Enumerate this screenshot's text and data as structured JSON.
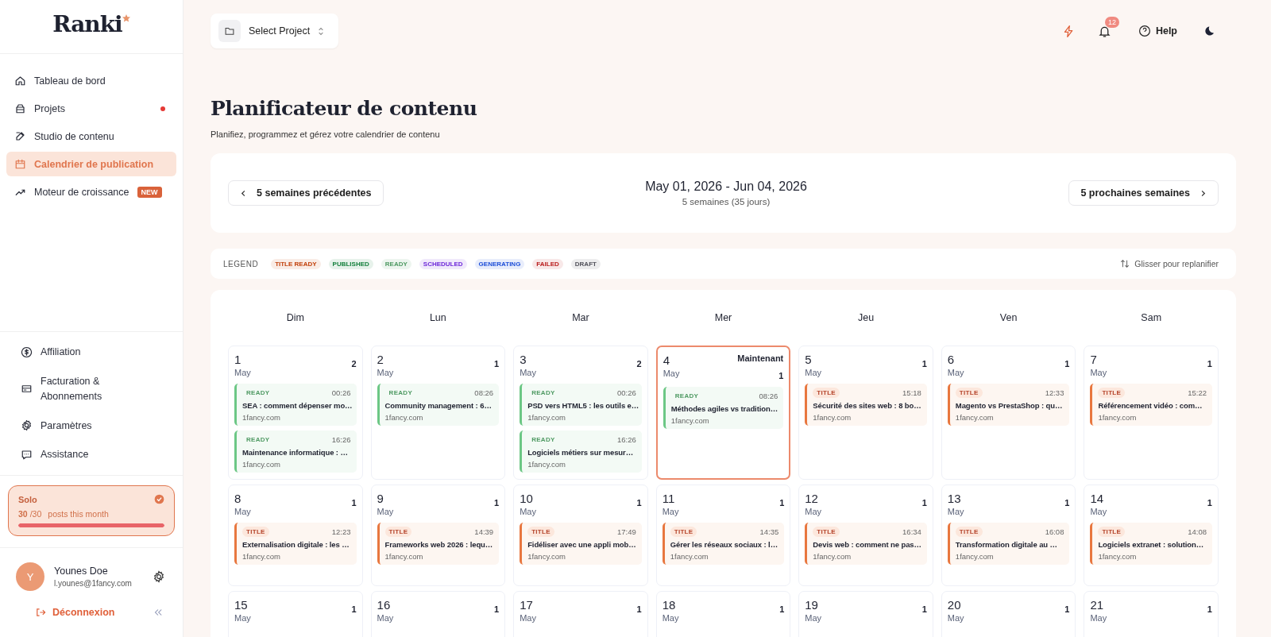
{
  "sidebar": {
    "logo": "Ranki",
    "nav": [
      {
        "label": "Tableau de bord",
        "selected": false,
        "dot": false
      },
      {
        "label": "Projets",
        "selected": false,
        "dot": true
      },
      {
        "label": "Studio de contenu",
        "selected": false,
        "dot": false
      },
      {
        "label": "Calendrier de publication",
        "selected": true,
        "dot": false
      },
      {
        "label": "Moteur de croissance",
        "selected": false,
        "dot": false,
        "badge": "NEW"
      }
    ],
    "secondary": [
      {
        "label": "Affiliation"
      },
      {
        "label": "Facturation & Abonnements"
      },
      {
        "label": "Paramètres"
      },
      {
        "label": "Assistance"
      }
    ],
    "plan": {
      "name": "Solo",
      "used": "30",
      "limit": "/30",
      "caption": "posts this month",
      "level": 1
    },
    "user": {
      "initial": "Y",
      "name": "Younes Doe",
      "email": "l.younes@1fancy.com"
    },
    "logout": "Déconnexion"
  },
  "topbar": {
    "project_select": "Select Project",
    "notifications": "12",
    "help": "Help"
  },
  "page": {
    "title": "Planificateur de contenu",
    "subtitle": "Planifiez, programmez et gérez votre calendrier de contenu"
  },
  "range": {
    "prev": "5 semaines précédentes",
    "title": "May 01, 2026 - Jun 04, 2026",
    "subtitle": "5 semaines (35 jours)",
    "next": "5 prochaines semaines"
  },
  "legend": {
    "label": "LEGEND",
    "hint": "Glisser pour replanifier",
    "items": [
      {
        "label": "TITLE READY",
        "color": "#c2410c"
      },
      {
        "label": "PUBLISHED",
        "color": "#15803d"
      },
      {
        "label": "READY",
        "color": "#4f9a63"
      },
      {
        "label": "SCHEDULED",
        "color": "#6d28d9"
      },
      {
        "label": "GENERATING",
        "color": "#1d4ed8"
      },
      {
        "label": "FAILED",
        "color": "#b91c1c"
      },
      {
        "label": "DRAFT",
        "color": "#52525b"
      }
    ]
  },
  "calendar": {
    "weekdays": [
      "Dim",
      "Lun",
      "Mar",
      "Mer",
      "Jeu",
      "Ven",
      "Sam"
    ],
    "days": [
      {
        "day": "1",
        "month": "May",
        "count": "2",
        "today": false,
        "events": [
          {
            "kind": "ready",
            "tag": "READY",
            "time": "00:26",
            "title": "SEA : comment dépenser mo…",
            "site": "1fancy.com"
          },
          {
            "kind": "ready",
            "tag": "READY",
            "time": "16:26",
            "title": "Maintenance informatique : …",
            "site": "1fancy.com"
          }
        ]
      },
      {
        "day": "2",
        "month": "May",
        "count": "1",
        "today": false,
        "events": [
          {
            "kind": "ready",
            "tag": "READY",
            "time": "08:26",
            "title": "Community management : 6…",
            "site": "1fancy.com"
          }
        ]
      },
      {
        "day": "3",
        "month": "May",
        "count": "2",
        "today": false,
        "events": [
          {
            "kind": "ready",
            "tag": "READY",
            "time": "00:26",
            "title": "PSD vers HTML5 : les outils e…",
            "site": "1fancy.com"
          },
          {
            "kind": "ready",
            "tag": "READY",
            "time": "16:26",
            "title": "Logiciels métiers sur mesur…",
            "site": "1fancy.com"
          }
        ]
      },
      {
        "day": "4",
        "month": "May",
        "count": "1",
        "today": true,
        "today_label": "Maintenant",
        "events": [
          {
            "kind": "ready",
            "tag": "READY",
            "time": "08:26",
            "title": "Méthodes agiles vs tradition…",
            "site": "1fancy.com"
          }
        ]
      },
      {
        "day": "5",
        "month": "May",
        "count": "1",
        "today": false,
        "events": [
          {
            "kind": "title",
            "tag": "TITLE",
            "time": "15:18",
            "title": "Sécurité des sites web : 8 bo…",
            "site": "1fancy.com"
          }
        ]
      },
      {
        "day": "6",
        "month": "May",
        "count": "1",
        "today": false,
        "events": [
          {
            "kind": "title",
            "tag": "TITLE",
            "time": "12:33",
            "title": "Magento vs PrestaShop : qu…",
            "site": "1fancy.com"
          }
        ]
      },
      {
        "day": "7",
        "month": "May",
        "count": "1",
        "today": false,
        "events": [
          {
            "kind": "title",
            "tag": "TITLE",
            "time": "15:22",
            "title": "Référencement vidéo : com…",
            "site": "1fancy.com"
          }
        ]
      },
      {
        "day": "8",
        "month": "May",
        "count": "1",
        "today": false,
        "events": [
          {
            "kind": "title",
            "tag": "TITLE",
            "time": "12:23",
            "title": "Externalisation digitale : les …",
            "site": "1fancy.com"
          }
        ]
      },
      {
        "day": "9",
        "month": "May",
        "count": "1",
        "today": false,
        "events": [
          {
            "kind": "title",
            "tag": "TITLE",
            "time": "14:39",
            "title": "Frameworks web 2026 : lequ…",
            "site": "1fancy.com"
          }
        ]
      },
      {
        "day": "10",
        "month": "May",
        "count": "1",
        "today": false,
        "events": [
          {
            "kind": "title",
            "tag": "TITLE",
            "time": "17:49",
            "title": "Fidéliser avec une appli mob…",
            "site": "1fancy.com"
          }
        ]
      },
      {
        "day": "11",
        "month": "May",
        "count": "1",
        "today": false,
        "events": [
          {
            "kind": "title",
            "tag": "TITLE",
            "time": "14:35",
            "title": "Gérer les réseaux sociaux : l…",
            "site": "1fancy.com"
          }
        ]
      },
      {
        "day": "12",
        "month": "May",
        "count": "1",
        "today": false,
        "events": [
          {
            "kind": "title",
            "tag": "TITLE",
            "time": "16:34",
            "title": "Devis web : comment ne pas…",
            "site": "1fancy.com"
          }
        ]
      },
      {
        "day": "13",
        "month": "May",
        "count": "1",
        "today": false,
        "events": [
          {
            "kind": "title",
            "tag": "TITLE",
            "time": "16:08",
            "title": "Transformation digitale au …",
            "site": "1fancy.com"
          }
        ]
      },
      {
        "day": "14",
        "month": "May",
        "count": "1",
        "today": false,
        "events": [
          {
            "kind": "title",
            "tag": "TITLE",
            "time": "14:08",
            "title": "Logiciels extranet : solution…",
            "site": "1fancy.com"
          }
        ]
      },
      {
        "day": "15",
        "month": "May",
        "count": "1",
        "today": false
      },
      {
        "day": "16",
        "month": "May",
        "count": "1",
        "today": false
      },
      {
        "day": "17",
        "month": "May",
        "count": "1",
        "today": false
      },
      {
        "day": "18",
        "month": "May",
        "count": "1",
        "today": false
      },
      {
        "day": "19",
        "month": "May",
        "count": "1",
        "today": false
      },
      {
        "day": "20",
        "month": "May",
        "count": "1",
        "today": false
      },
      {
        "day": "21",
        "month": "May",
        "count": "1",
        "today": false
      }
    ]
  }
}
